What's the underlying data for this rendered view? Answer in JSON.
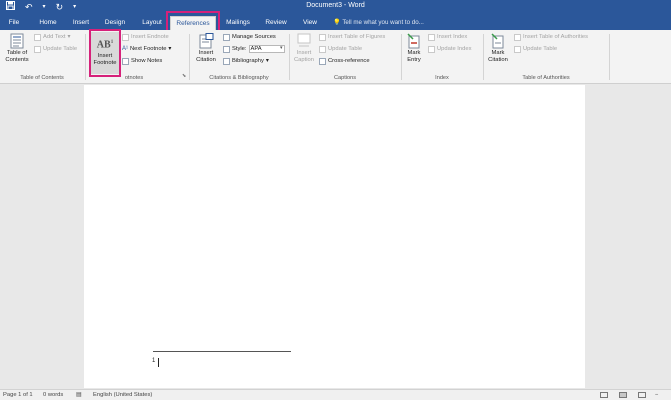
{
  "window": {
    "title": "Document3 - Word"
  },
  "qat": {
    "save_icon": "save-icon",
    "undo_icon": "undo-icon",
    "redo_icon": "redo-icon"
  },
  "tabs": [
    "File",
    "Home",
    "Insert",
    "Design",
    "Layout",
    "References",
    "Mailings",
    "Review",
    "View"
  ],
  "active_tab": "References",
  "tell_me": "Tell me what you want to do...",
  "ribbon": {
    "toc": {
      "table_of_contents_line1": "Table of",
      "table_of_contents_line2": "Contents",
      "add_text": "Add Text",
      "update_table": "Update Table",
      "group_label": "Table of Contents"
    },
    "footnotes": {
      "insert_footnote_line1": "Insert",
      "insert_footnote_line2": "Footnote",
      "ab_glyph": "AB",
      "ab_superscript": "1",
      "insert_endnote": "Insert Endnote",
      "next_footnote": "Next Footnote",
      "show_notes": "Show Notes",
      "group_label": "otnotes"
    },
    "citations": {
      "insert_citation_line1": "Insert",
      "insert_citation_line2": "Citation",
      "manage_sources": "Manage Sources",
      "style_label": "Style:",
      "style_value": "APA",
      "bibliography": "Bibliography",
      "group_label": "Citations & Bibliography"
    },
    "captions": {
      "insert_caption_line1": "Insert",
      "insert_caption_line2": "Caption",
      "insert_table_of_figures": "Insert Table of Figures",
      "update_table": "Update Table",
      "cross_reference": "Cross-reference",
      "group_label": "Captions"
    },
    "index": {
      "mark_entry_line1": "Mark",
      "mark_entry_line2": "Entry",
      "insert_index": "Insert Index",
      "update_index": "Update Index",
      "group_label": "Index"
    },
    "authorities": {
      "mark_citation_line1": "Mark",
      "mark_citation_line2": "Citation",
      "insert_table_of_authorities": "Insert Table of Authorities",
      "update_table": "Update Table",
      "group_label": "Table of Authorities"
    }
  },
  "document": {
    "footnote_number": "1"
  },
  "status": {
    "page": "Page 1 of 1",
    "words": "0 words",
    "language": "English (United States)"
  },
  "colors": {
    "brand": "#2b579a",
    "highlight": "#d6217a"
  }
}
